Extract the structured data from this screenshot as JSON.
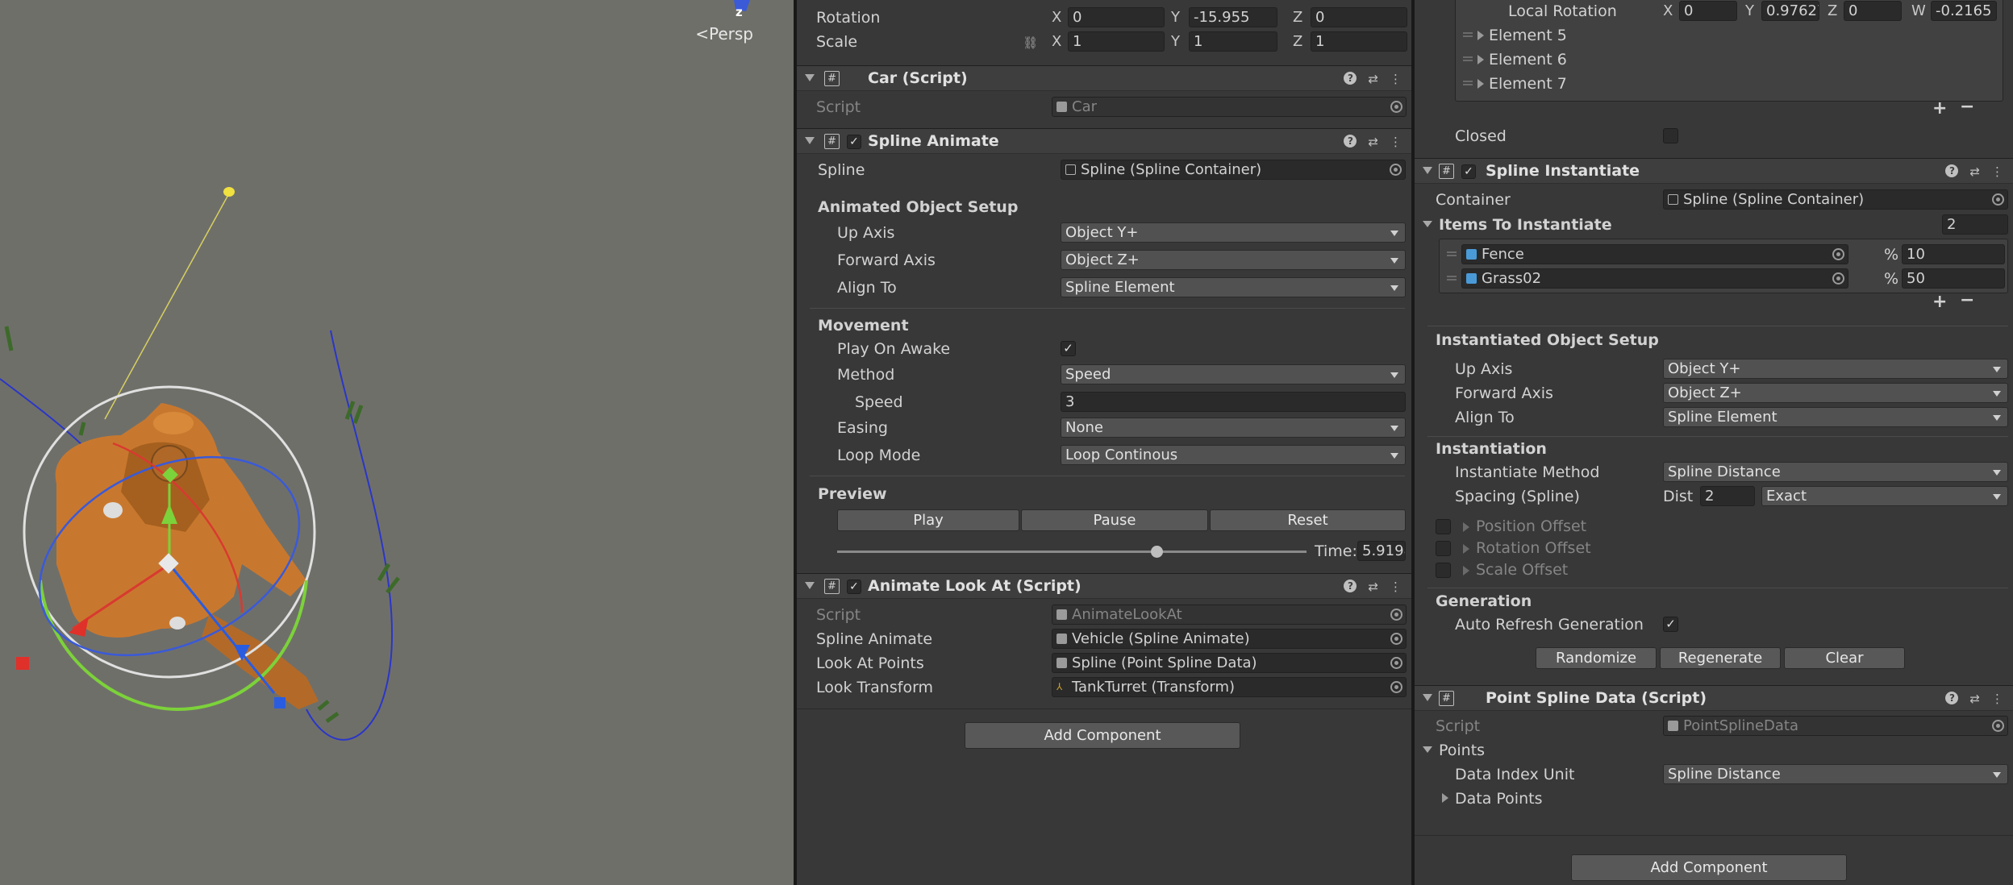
{
  "scene": {
    "persp_label": "Persp",
    "gizmo_axis": "z"
  },
  "colors": {
    "scene_bg": "#6f6f6a",
    "inspector_bg": "#383838",
    "tank_orange": "#c8782e",
    "gizmo_green": "#7cd23a",
    "gizmo_red": "#e0302a",
    "gizmo_blue": "#2a5ce0",
    "spline_blue": "#2a36c8"
  },
  "insp1": {
    "transform": {
      "rotation_label": "Rotation",
      "rot_x": "0",
      "rot_y": "-15.955",
      "rot_z": "0",
      "scale_label": "Scale",
      "scale_x": "1",
      "scale_y": "1",
      "scale_z": "1",
      "x": "X",
      "y": "Y",
      "z": "Z"
    },
    "car": {
      "title": "Car (Script)",
      "script_label": "Script",
      "script_value": "Car"
    },
    "spline_animate": {
      "title": "Spline Animate",
      "spline_label": "Spline",
      "spline_value": "Spline (Spline Container)",
      "setup_header": "Animated Object Setup",
      "up_axis_label": "Up Axis",
      "up_axis_value": "Object Y+",
      "forward_axis_label": "Forward Axis",
      "forward_axis_value": "Object Z+",
      "align_to_label": "Align To",
      "align_to_value": "Spline Element",
      "movement_header": "Movement",
      "play_on_awake_label": "Play On Awake",
      "method_label": "Method",
      "method_value": "Speed",
      "speed_label": "Speed",
      "speed_value": "3",
      "easing_label": "Easing",
      "easing_value": "None",
      "loop_mode_label": "Loop Mode",
      "loop_mode_value": "Loop Continous",
      "preview_header": "Preview",
      "play_btn": "Play",
      "pause_btn": "Pause",
      "reset_btn": "Reset",
      "time_label": "Time:",
      "time_value": "5.9198",
      "time_fraction": 0.68
    },
    "animate_look_at": {
      "title": "Animate Look At (Script)",
      "script_label": "Script",
      "script_value": "AnimateLookAt",
      "spline_animate_label": "Spline Animate",
      "spline_animate_value": "Vehicle (Spline Animate)",
      "look_at_points_label": "Look At Points",
      "look_at_points_value": "Spline (Point Spline Data)",
      "look_transform_label": "Look Transform",
      "look_transform_value": "TankTurret (Transform)"
    },
    "add_component": "Add Component"
  },
  "insp2": {
    "local_rotation": {
      "label": "Local Rotation",
      "x": "0",
      "y": "0.97627",
      "z": "0",
      "w": "-0.2165"
    },
    "elements": [
      "Element 5",
      "Element 6",
      "Element 7"
    ],
    "closed_label": "Closed",
    "spline_instantiate": {
      "title": "Spline Instantiate",
      "container_label": "Container",
      "container_value": "Spline (Spline Container)",
      "items_label": "Items To Instantiate",
      "items_count": "2",
      "items": [
        {
          "name": "Fence",
          "percent": "10"
        },
        {
          "name": "Grass02",
          "percent": "50"
        }
      ],
      "percent_sign": "%",
      "setup_header": "Instantiated Object Setup",
      "up_axis_label": "Up Axis",
      "up_axis_value": "Object Y+",
      "forward_axis_label": "Forward Axis",
      "forward_axis_value": "Object Z+",
      "align_to_label": "Align To",
      "align_to_value": "Spline Element",
      "instantiation_header": "Instantiation",
      "method_label": "Instantiate Method",
      "method_value": "Spline Distance",
      "spacing_label": "Spacing (Spline)",
      "dist_label": "Dist",
      "dist_value": "2",
      "spacing_mode": "Exact",
      "position_offset": "Position Offset",
      "rotation_offset": "Rotation Offset",
      "scale_offset": "Scale Offset",
      "generation_header": "Generation",
      "auto_refresh_label": "Auto Refresh Generation",
      "randomize_btn": "Randomize",
      "regenerate_btn": "Regenerate",
      "clear_btn": "Clear"
    },
    "point_spline_data": {
      "title": "Point Spline Data (Script)",
      "script_label": "Script",
      "script_value": "PointSplineData",
      "points_label": "Points",
      "data_index_label": "Data Index Unit",
      "data_index_value": "Spline Distance",
      "data_points_label": "Data Points"
    },
    "add_component": "Add Component"
  }
}
